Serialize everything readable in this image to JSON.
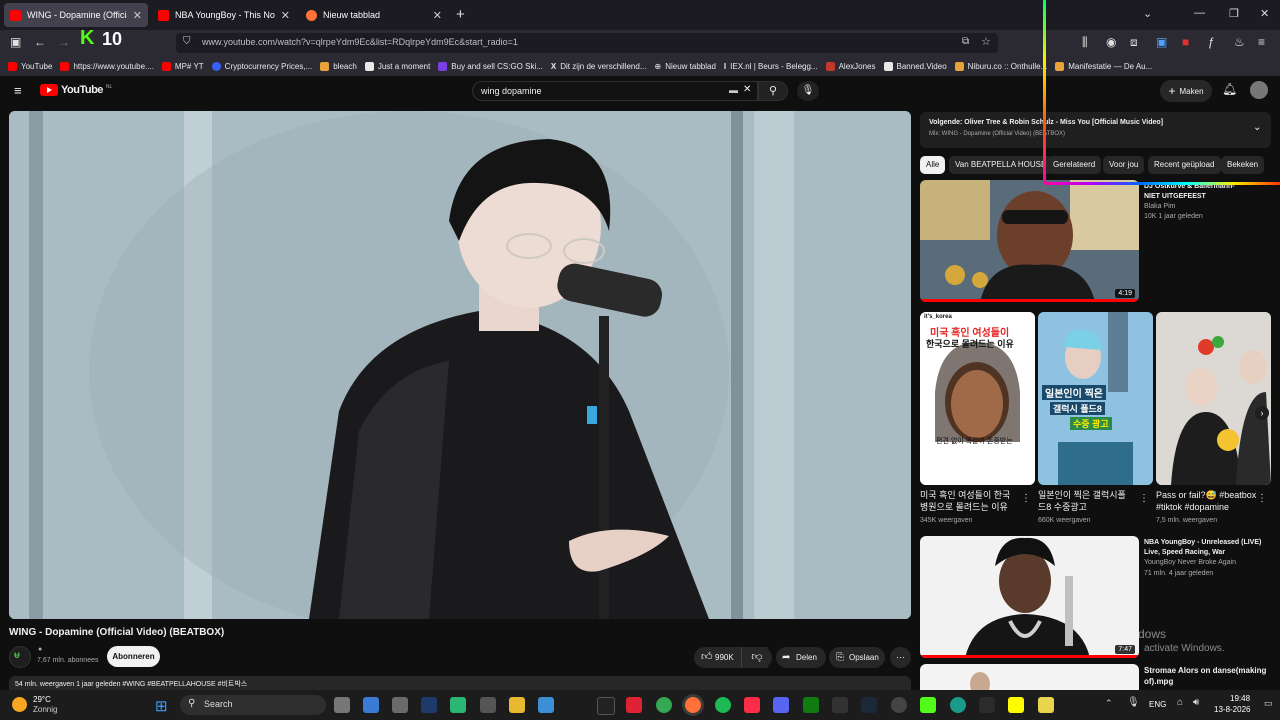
{
  "tabs": [
    {
      "title": "WING - Dopamine (Official",
      "color": "#ff0000",
      "active": true
    },
    {
      "title": "NBA YoungBoy - This Not a Son",
      "color": "#ff0000",
      "active": false
    },
    {
      "title": "Nieuw tabblad",
      "color": "#ff7139",
      "active": false
    }
  ],
  "nav": {
    "url": "www.youtube.com/watch?v=qlrpeYdm9Ec&list=RDqlrpeYdm9Ec&start_radio=1",
    "badge_letter": "K",
    "badge_number": "10"
  },
  "bookmarks": [
    {
      "label": "YouTube",
      "color": "#ff0000"
    },
    {
      "label": "https://www.youtube....",
      "color": "#ff0000"
    },
    {
      "label": "MP# YT",
      "color": "#ff0000"
    },
    {
      "label": "Cryptocurrency Prices,...",
      "color": "#3861fb"
    },
    {
      "label": "bleach",
      "color": "#e8a23a"
    },
    {
      "label": "Just a moment",
      "color": "#e8e8e8"
    },
    {
      "label": "Buy and sell CS:GO Ski...",
      "color": "#7b3fe4"
    },
    {
      "label": "Dit zijn de verschillend...",
      "color": "#e8e8e8"
    },
    {
      "label": "Nieuw tabblad",
      "color": "#e8e8e8"
    },
    {
      "label": "IEX.nl | Beurs - Belegg...",
      "color": "#e8e8e8"
    },
    {
      "label": "AlexJones",
      "color": "#c0392b"
    },
    {
      "label": "Banned.Video",
      "color": "#e8e8e8"
    },
    {
      "label": "Niburu.co :: Onthulle...",
      "color": "#e8a23a"
    },
    {
      "label": "Manifestatie — De Au...",
      "color": "#e8a23a"
    }
  ],
  "youtube": {
    "logo": "YouTube",
    "country": "NL",
    "search_value": "wing dopamine",
    "create_label": "Maken"
  },
  "video": {
    "title": "WING - Dopamine (Official Video) (BEATBOX)",
    "channel_subs": "7,67 mln. abonnees",
    "subscribe": "Abonneren",
    "likes": "990K",
    "share": "Delen",
    "save": "Opslaan",
    "desc_line": "54 mln. weergaven 1 jaar geleden #WING #BEATPELLAHOUSE #비트박스"
  },
  "up_next": {
    "label": "Volgende: Oliver Tree & Robin Schulz - Miss You [Official Music Video]",
    "mix": "Mix: WING - Dopamine (Official Video) (BEATBOX)"
  },
  "chips": [
    "Alle",
    "Van BEATPELLA HOUSE",
    "Gerelateerd",
    "Voor jou",
    "Recent geüpload",
    "Bekeken"
  ],
  "recs": [
    {
      "title_line1": "DJ Ostkurve & Ballermann-",
      "title_line2": "NIET UITGEFEEST",
      "channel": "Blaka Pim",
      "stats": "10K  1 jaar geleden",
      "duration": "4:19"
    },
    {
      "title_line1": "NBA YoungBoy - Unreleased (LIVE)",
      "title_line2": "Live, Speed Racing, War",
      "channel": "YoungBoy Never Broke Again",
      "stats": "71 mln.  4 jaar geleden",
      "duration": "7:47"
    },
    {
      "title_line1": "Stromae   Alors on danse(making",
      "title_line2": "of).mpg"
    }
  ],
  "shorts": [
    {
      "title_line1": "미국 흑인 여성들이 한국",
      "title_line2": "병원으로 몰려드는 이유",
      "views": "345K weergaven",
      "tag": "it's_korea",
      "overlay1": "미국 흑인 여성들이",
      "overlay2": "한국으로 몰려드는 이유",
      "caption": "편견 없이 똑같이 존중받는"
    },
    {
      "title_line1": "일본인이 찍은 갤럭시폴",
      "title_line2": "드8 수중광고",
      "views": "660K weergaven",
      "overlay1": "일본인이 찍은",
      "overlay2": "갤럭시 폴드8",
      "overlay3": "수중 광고"
    },
    {
      "title_line1": "Pass or fail?😅 #beatbox",
      "title_line2": "#tiktok #dopamine",
      "views": "7,5 mln. weergaven"
    }
  ],
  "watermark": {
    "line1": "dows",
    "line2": "activate Windows."
  },
  "taskbar": {
    "temp": "29°C",
    "weather": "Zonnig",
    "search": "Search",
    "lang": "ENG",
    "time": "19:48",
    "date": "13-8-2026"
  }
}
